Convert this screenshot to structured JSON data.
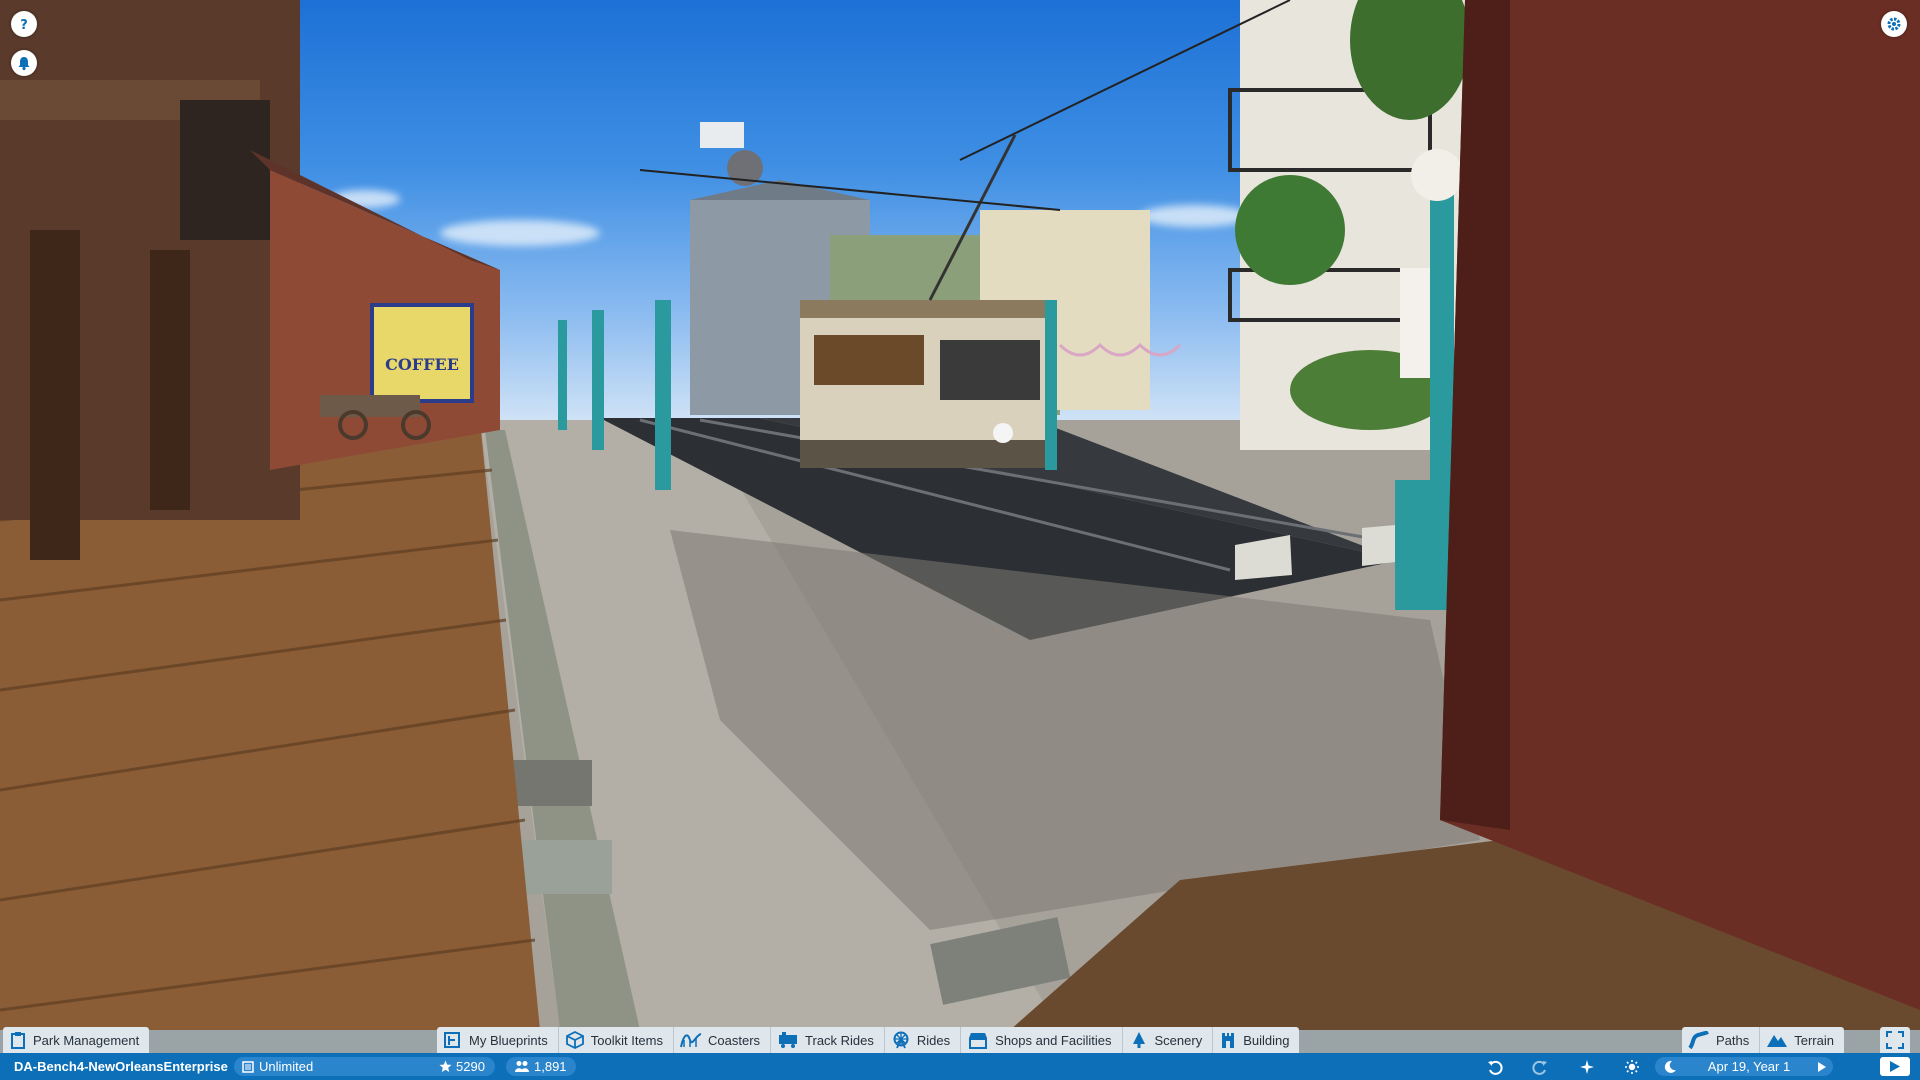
{
  "hud": {
    "help_icon": "question-mark",
    "notifications_icon": "bell",
    "settings_icon": "gear"
  },
  "toolbar": {
    "park_management": "Park Management",
    "my_blueprints": "My Blueprints",
    "toolkit_items": "Toolkit Items",
    "coasters": "Coasters",
    "track_rides": "Track Rides",
    "rides": "Rides",
    "shops_and_facilities": "Shops and Facilities",
    "scenery": "Scenery",
    "building": "Building",
    "paths": "Paths",
    "terrain": "Terrain"
  },
  "status": {
    "park_name": "DA-Bench4-NewOrleansEnterprise",
    "money": "Unlimited",
    "rating": "5290",
    "guests": "1,891",
    "date": "Apr 19, Year 1"
  },
  "scene": {
    "sign_text": "COFFEE"
  },
  "colors": {
    "status_bar": "#0d6fb8",
    "toolbar_bg": "#dfe6ec",
    "accent": "#2b85cc"
  }
}
